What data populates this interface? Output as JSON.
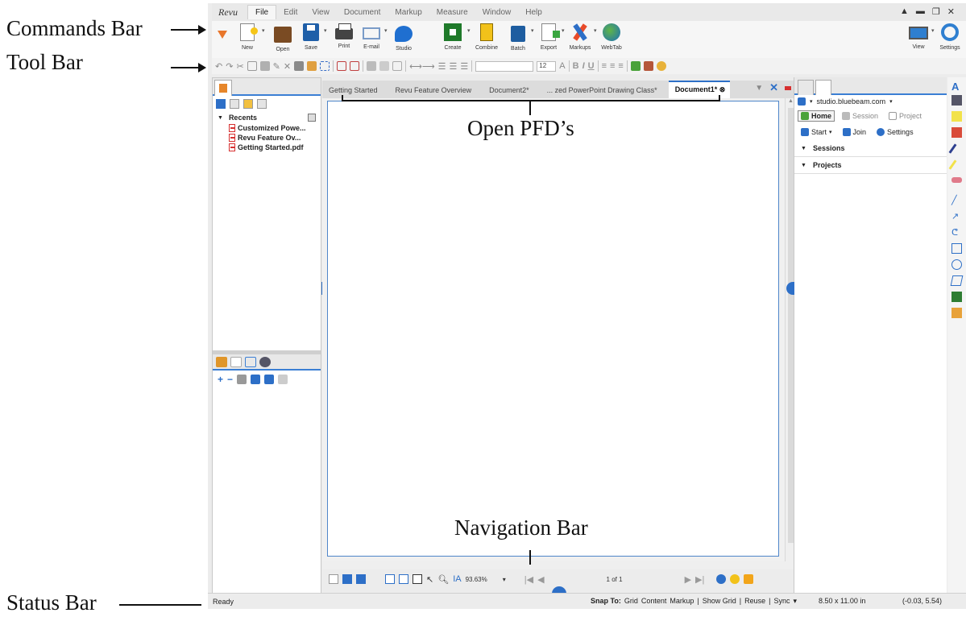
{
  "annotations": {
    "commands_bar": "Commands Bar",
    "tool_bar": "Tool Bar",
    "open_pdfs": "Open PFD’s",
    "navigation_bar": "Navigation Bar",
    "status_bar": "Status Bar"
  },
  "app": {
    "logo": "Revu"
  },
  "menu": [
    "File",
    "Edit",
    "View",
    "Document",
    "Markup",
    "Measure",
    "Window",
    "Help"
  ],
  "window_controls": [
    "▲",
    "▬",
    "❐",
    "✕"
  ],
  "commands": {
    "new": "New",
    "open": "Open",
    "save": "Save",
    "print": "Print",
    "email": "E-mail",
    "studio": "Studio",
    "create": "Create",
    "combine": "Combine",
    "batch": "Batch",
    "export": "Export",
    "markups": "Markups",
    "webtab": "WebTab",
    "view": "View",
    "settings": "Settings"
  },
  "toolbar": {
    "font_size": "12",
    "bold": "B",
    "italic": "I",
    "underline": "U"
  },
  "left_panel": {
    "recents_label": "Recents",
    "recent_files": [
      "Customized Powe...",
      "Revu Feature Ov...",
      "Getting Started.pdf"
    ]
  },
  "doc_tabs": [
    "Getting Started",
    "Revu Feature Overview",
    "Document2*",
    "... zed PowerPoint Drawing Class*",
    "Document1*"
  ],
  "navigation": {
    "zoom": "93.63%",
    "page_indicator": "1 of 1"
  },
  "right_panel": {
    "server": "studio.bluebeam.com",
    "home": "Home",
    "session": "Session",
    "project": "Project",
    "start": "Start",
    "join": "Join",
    "settings": "Settings",
    "sessions": "Sessions",
    "projects": "Projects"
  },
  "status": {
    "ready": "Ready",
    "snap_to": "Snap To:",
    "grid": "Grid",
    "content": "Content",
    "markup": "Markup",
    "show_grid": "Show Grid",
    "reuse": "Reuse",
    "sync": "Sync",
    "page_size": "8.50 x 11.00 in",
    "coordinates": "(-0.03, 5.54)"
  },
  "colors": {
    "accent": "#2d6fc7",
    "frame_strip": "#2f5fa7"
  }
}
